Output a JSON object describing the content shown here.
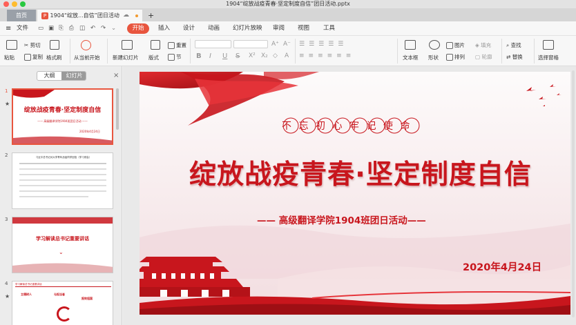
{
  "window": {
    "title": "1904“绽放战疫青春·坚定制度自信”团日活动.pptx"
  },
  "tabs": {
    "home": "首页",
    "doc_badge": "P",
    "doc": "1904“绽放...自信”团日活动",
    "add": "+"
  },
  "menubar": {
    "file": "文件",
    "items": [
      "开始",
      "插入",
      "设计",
      "动画",
      "幻灯片放映",
      "审阅",
      "视图",
      "工具"
    ]
  },
  "ribbon": {
    "paste": "粘贴",
    "cut": "剪切",
    "copy": "复制",
    "format_painter": "格式刷",
    "from_current": "从当前开始",
    "new_slide": "新建幻灯片",
    "layout": "版式",
    "reset": "重置",
    "section": "节",
    "textbox": "文本框",
    "shape": "形状",
    "picture": "图片",
    "fill": "填充",
    "arrange": "排列",
    "outline": "轮廓",
    "find": "查找",
    "replace": "替换",
    "select_pane": "选择窗格",
    "bold": "B",
    "italic": "I",
    "underline": "U",
    "strike": "S"
  },
  "leftpane": {
    "tab_outline": "大纲",
    "tab_slides": "幻灯片",
    "close": "×",
    "thumbs": [
      {
        "num": "1",
        "title": "绽放战疫青春·坚定制度自信",
        "sub": "—— 高级翻译学院1904班团日活动 ——",
        "date": "2020年4月24日"
      },
      {
        "num": "2",
        "title": "习近平总书记对大学青年战疫同学回信（学习领会）"
      },
      {
        "num": "3",
        "title": "学习解读总书记重要讲话"
      },
      {
        "num": "4",
        "title": "学习解读总书记重要讲话",
        "items": [
          "立德树人",
          "与担当者",
          "报效祖国"
        ]
      }
    ]
  },
  "slide": {
    "seal_text": "不忘初心牢记使命",
    "title": "绽放战疫青春·坚定制度自信",
    "subtitle": "—— 高级翻译学院1904班团日活动——",
    "date": "2020年4月24日"
  },
  "colors": {
    "accent": "#e8553e",
    "brand_red": "#c8161d",
    "active_tab": "#f7f7f7"
  }
}
